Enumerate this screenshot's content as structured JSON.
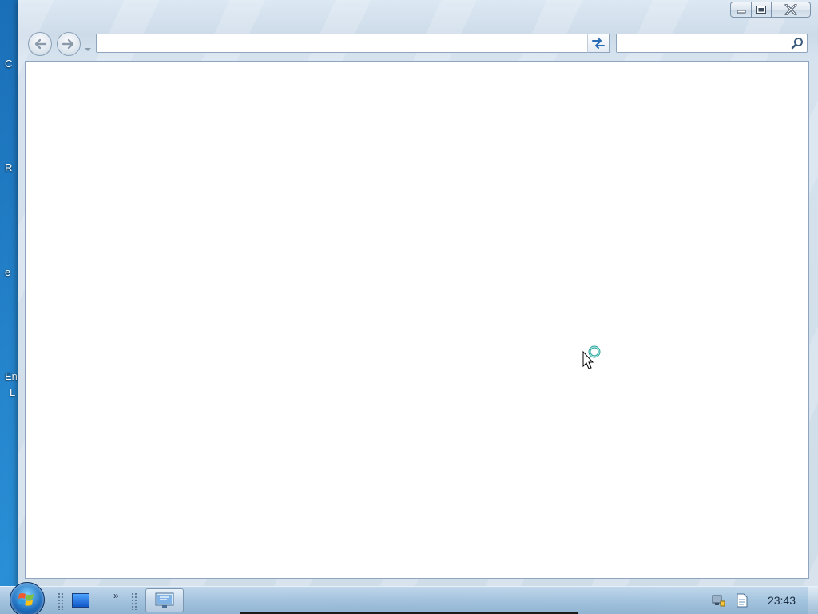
{
  "desktop": {
    "label_fragments": [
      "C",
      "R",
      "e",
      "En",
      "L"
    ]
  },
  "window": {
    "caption": {
      "minimize_icon": "minimize-icon",
      "maximize_icon": "maximize-icon",
      "close_icon": "close-icon"
    },
    "nav": {
      "back_icon": "arrow-left-icon",
      "forward_icon": "arrow-right-icon",
      "address_value": "",
      "search_value": ""
    }
  },
  "taskbar": {
    "clock": "23:43",
    "tray_icons": [
      "network-icon",
      "document-icon"
    ]
  }
}
